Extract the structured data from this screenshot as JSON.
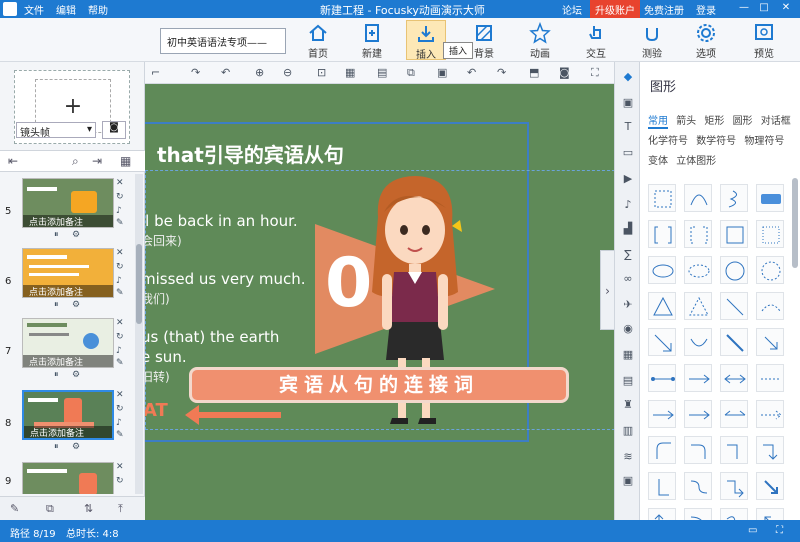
{
  "titlebar": {
    "menus": [
      "文件",
      "编辑",
      "帮助"
    ],
    "title": "新建工程 - Focusky动画演示大师",
    "links": [
      "论坛",
      "免费注册",
      "登录"
    ],
    "upgrade": "升级账户",
    "window_controls": [
      "—",
      "□",
      "✕"
    ]
  },
  "toolbar": {
    "project_name": "初中英语语法专项——",
    "buttons": [
      {
        "label": "首页",
        "icon": "home-icon"
      },
      {
        "label": "新建",
        "icon": "new-file-icon"
      },
      {
        "label": "插入",
        "icon": "insert-icon",
        "active": true
      },
      {
        "label": "背景",
        "icon": "background-icon"
      },
      {
        "label": "动画",
        "icon": "star-animation-icon"
      },
      {
        "label": "交互",
        "icon": "interaction-icon"
      },
      {
        "label": "测验",
        "icon": "quiz-icon"
      },
      {
        "label": "选项",
        "icon": "gear-icon"
      },
      {
        "label": "预览",
        "icon": "preview-icon"
      }
    ],
    "tooltip": "插入"
  },
  "leftpanel": {
    "frame_select": "镜头帧",
    "slides": [
      {
        "num": "5",
        "note": "点击添加备注",
        "bg": "#6e8d5f",
        "accent": "#f5a623"
      },
      {
        "num": "6",
        "note": "点击添加备注",
        "bg": "#f2b03a",
        "accent": "#e88a2a"
      },
      {
        "num": "7",
        "note": "点击添加备注",
        "bg": "#e9efe3",
        "accent": "#4a90d9"
      },
      {
        "num": "8",
        "note": "点击添加备注",
        "bg": "#5a8157",
        "accent": "#f07a55",
        "selected": true
      },
      {
        "num": "9",
        "note": "",
        "bg": "#6e8d5f",
        "accent": "#f07a55"
      }
    ]
  },
  "canvas": {
    "heading": "that引导的宾语从句",
    "lines": [
      {
        "en": "ll be back in an hour.",
        "zh": "会回来)"
      },
      {
        "en": "missed us very much.",
        "zh": "我们)"
      },
      {
        "en": "us (that) the earth",
        "zh": ""
      },
      {
        "en": "e sun.",
        "zh": "旧转)"
      }
    ],
    "big_number": "0",
    "banner": "宾语从句的连接词",
    "orange_text": "AT"
  },
  "shapepanel": {
    "title": "图形",
    "tabs": [
      "常用",
      "箭头",
      "矩形",
      "圆形",
      "对话框",
      "化学符号",
      "数学符号",
      "物理符号",
      "变体",
      "立体图形"
    ],
    "active_tab": "常用"
  },
  "statusbar": {
    "path_label": "路径 8/19",
    "duration_label": "总时长: 4:8"
  }
}
